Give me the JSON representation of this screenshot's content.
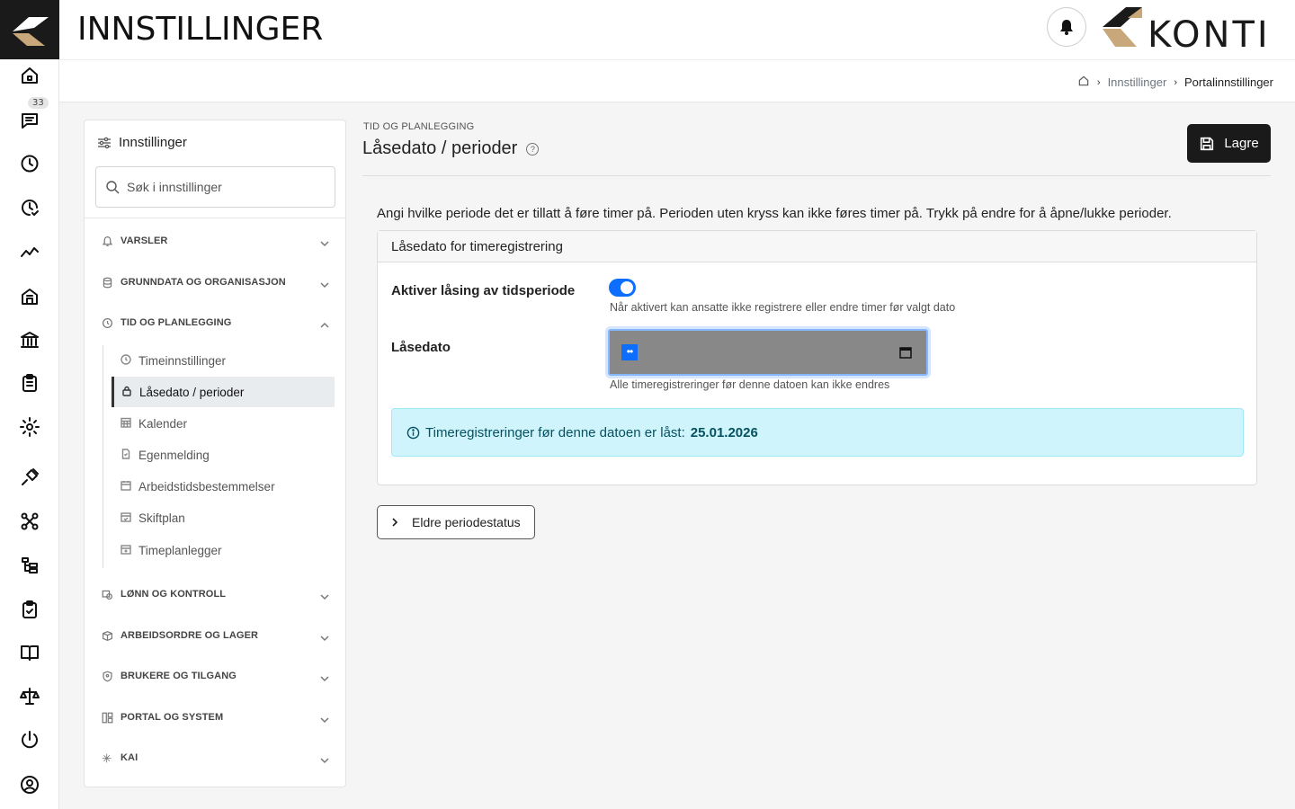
{
  "header": {
    "title": "INNSTILLINGER",
    "brand_name": "KONTI"
  },
  "rail": {
    "messages_badge": "33",
    "icons": [
      "home-icon",
      "messages-icon",
      "clock-icon",
      "clock-check-icon",
      "trend-icon",
      "building-icon",
      "bank-icon",
      "clipboard-icon",
      "settings-icon",
      "plug-icon",
      "network-icon",
      "hierarchy-icon",
      "clipboard-check-icon",
      "book-icon",
      "scale-icon",
      "power-icon",
      "user-circle-icon"
    ]
  },
  "breadcrumb": {
    "items": [
      "Innstillinger",
      "Portalinnstillinger"
    ]
  },
  "settings_panel": {
    "title": "Innstillinger",
    "search_placeholder": "Søk i innstillinger",
    "sections": [
      {
        "label": "VARSLER",
        "icon": "bell-icon",
        "expanded": false
      },
      {
        "label": "GRUNNDATA OG ORGANISASJON",
        "icon": "database-icon",
        "expanded": false
      },
      {
        "label": "TID OG PLANLEGGING",
        "icon": "clock-icon",
        "expanded": true
      },
      {
        "label": "LØNN OG KONTROLL",
        "icon": "payroll-icon",
        "expanded": false
      },
      {
        "label": "ARBEIDSORDRE OG LAGER",
        "icon": "box-icon",
        "expanded": false
      },
      {
        "label": "BRUKERE OG TILGANG",
        "icon": "shield-icon",
        "expanded": false
      },
      {
        "label": "PORTAL OG SYSTEM",
        "icon": "layout-icon",
        "expanded": false
      },
      {
        "label": "KAI",
        "icon": "sparkle-icon",
        "expanded": false
      }
    ],
    "sub_items": [
      {
        "label": "Timeinnstillinger",
        "icon": "clock-icon"
      },
      {
        "label": "Låsedato / perioder",
        "icon": "lock-icon",
        "active": true
      },
      {
        "label": "Kalender",
        "icon": "calendar-grid-icon"
      },
      {
        "label": "Egenmelding",
        "icon": "document-icon"
      },
      {
        "label": "Arbeidstidsbestemmelser",
        "icon": "calendar-icon"
      },
      {
        "label": "Skiftplan",
        "icon": "calendar-check-icon"
      },
      {
        "label": "Timeplanlegger",
        "icon": "calendar-plus-icon"
      }
    ]
  },
  "main": {
    "eyebrow": "TID OG PLANLEGGING",
    "title": "Låsedato / perioder",
    "help_glyph": "?",
    "save_label": "Lagre",
    "description": "Angi hvilke periode det er tillatt å føre timer på. Perioden uten kryss kan ikke føres timer på. Trykk på endre for å åpne/lukke perioder.",
    "card": {
      "header": "Låsedato for timeregistrering",
      "toggle_label": "Aktiver låsing av tidsperiode",
      "toggle_on": true,
      "toggle_hint": "Når aktivert kan ansatte ikke registrere eller endre timer før valgt dato",
      "date_label": "Låsedato",
      "date_selected_segment": "••",
      "date_hint": "Alle timeregistreringer før denne datoen kan ikke endres",
      "alert_text": "Timeregistreringer før denne datoen er låst:",
      "alert_date": "25.01.2026"
    },
    "older_button": "Eldre periodestatus"
  },
  "colors": {
    "primary": "#0d6efd",
    "dark": "#1a1a1a",
    "alert_bg": "#cff4fc",
    "brand_gold": "#c8a87a"
  }
}
